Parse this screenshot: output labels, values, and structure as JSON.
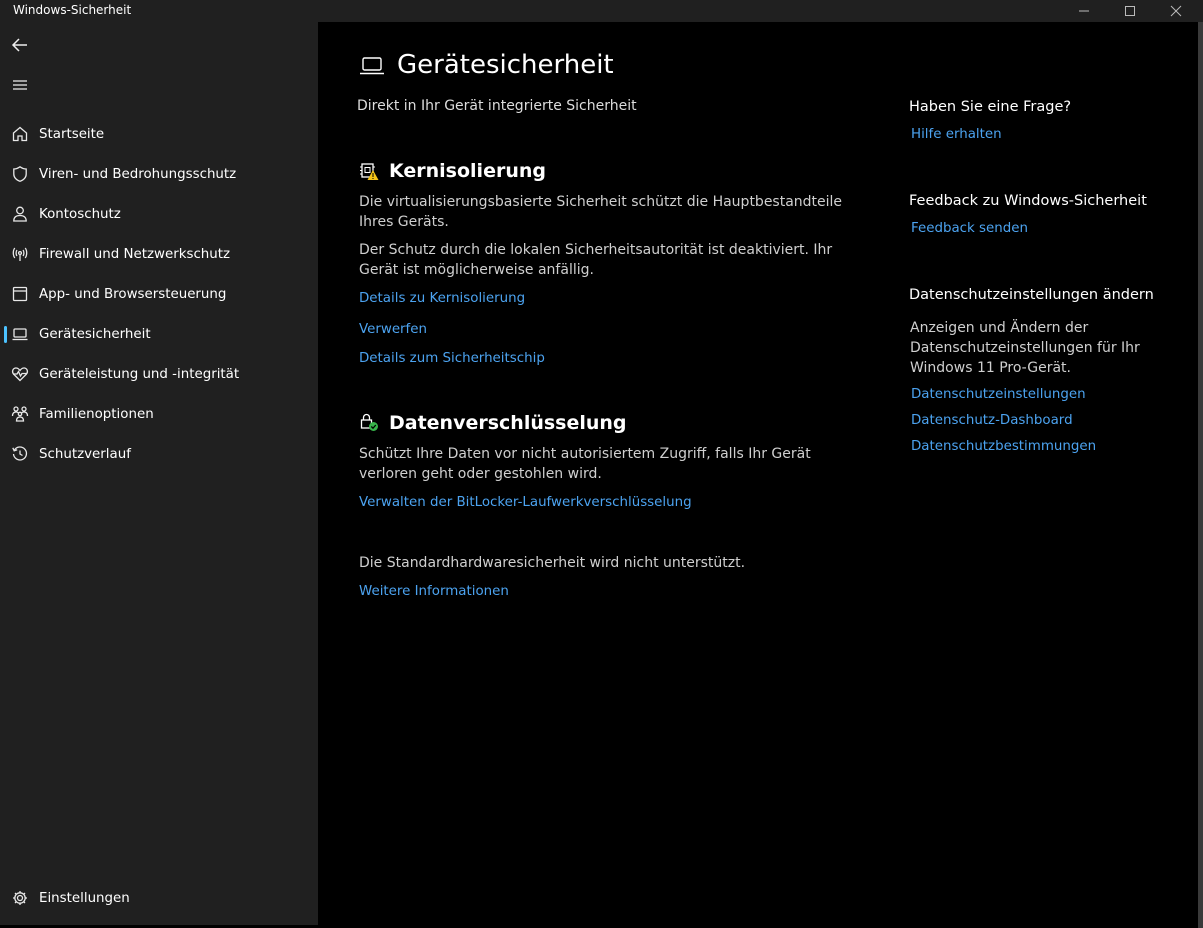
{
  "window": {
    "title": "Windows-Sicherheit"
  },
  "sidebar": {
    "items": [
      {
        "label": "Startseite",
        "icon": "home-icon"
      },
      {
        "label": "Viren- und Bedrohungsschutz",
        "icon": "shield-icon"
      },
      {
        "label": "Kontoschutz",
        "icon": "person-icon"
      },
      {
        "label": "Firewall und Netzwerkschutz",
        "icon": "antenna-icon"
      },
      {
        "label": "App- und Browsersteuerung",
        "icon": "browser-window-icon"
      },
      {
        "label": "Gerätesicherheit",
        "icon": "laptop-icon",
        "active": true
      },
      {
        "label": "Geräteleistung und -integrität",
        "icon": "heart-pulse-icon"
      },
      {
        "label": "Familienoptionen",
        "icon": "family-icon"
      },
      {
        "label": "Schutzverlauf",
        "icon": "history-icon"
      }
    ],
    "settings_label": "Einstellungen"
  },
  "main": {
    "title": "Gerätesicherheit",
    "subtitle": "Direkt in Ihr Gerät integrierte Sicherheit",
    "core_isolation": {
      "title": "Kernisolierung",
      "desc1": "Die virtualisierungsbasierte Sicherheit schützt die Hauptbestandteile Ihres Geräts.",
      "desc2": "Der Schutz durch die lokalen Sicherheitsautorität ist deaktiviert. Ihr Gerät ist möglicherweise anfällig.",
      "link_details": "Details zu Kernisolierung",
      "link_dismiss": "Verwerfen",
      "link_chip": "Details zum Sicherheitschip"
    },
    "encryption": {
      "title": "Datenverschlüsselung",
      "desc": "Schützt Ihre Daten vor nicht autorisiertem Zugriff, falls Ihr Gerät verloren geht oder gestohlen wird.",
      "link_bitlocker": "Verwalten der BitLocker-Laufwerkverschlüsselung"
    },
    "hardware": {
      "desc": "Die Standardhardwaresicherheit wird nicht unterstützt.",
      "link_more": "Weitere Informationen"
    }
  },
  "right": {
    "question_title": "Haben Sie eine Frage?",
    "question_link": "Hilfe erhalten",
    "feedback_title": "Feedback zu Windows-Sicherheit",
    "feedback_link": "Feedback senden",
    "privacy_title": "Datenschutzeinstellungen ändern",
    "privacy_desc": "Anzeigen und Ändern der Datenschutzeinstellungen für Ihr Windows 11 Pro-Gerät.",
    "privacy_links": [
      "Datenschutzeinstellungen",
      "Datenschutz-Dashboard",
      "Datenschutzbestimmungen"
    ]
  },
  "colors": {
    "accent": "#4cc2ff",
    "link": "#4ca3f0",
    "warning": "#f5c518",
    "ok": "#37b34a"
  }
}
